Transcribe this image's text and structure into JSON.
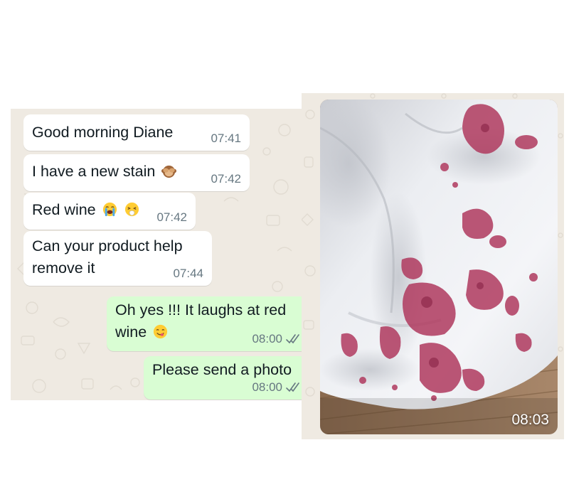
{
  "messages": [
    {
      "direction": "incoming",
      "text": "Good morning Diane",
      "time": "07:41"
    },
    {
      "direction": "incoming",
      "text": "I have a new stain",
      "emoji": [
        "see-no-evil-monkey"
      ],
      "time": "07:42"
    },
    {
      "direction": "incoming",
      "text": "Red wine",
      "emoji": [
        "loudly-crying-face",
        "sneezing-face"
      ],
      "time": "07:42"
    },
    {
      "direction": "incoming",
      "lines": [
        "Can your product help",
        "remove it"
      ],
      "time": "07:44"
    },
    {
      "direction": "outgoing",
      "lines": [
        "Oh yes !!! It laughs at red",
        "wine"
      ],
      "emoji": [
        "face-savoring-food"
      ],
      "time": "08:00",
      "status": "read-double-check"
    },
    {
      "direction": "outgoing",
      "text": "Please send a photo",
      "time": "08:00",
      "status": "read-double-check"
    }
  ],
  "photo": {
    "subject": "white duvet with red wine stains",
    "time": "08:03"
  },
  "colors": {
    "chat_background": "#efeae2",
    "incoming_bubble": "#ffffff",
    "outgoing_bubble": "#d9fdd3",
    "timestamp": "#667781",
    "wine_stain": "#b03a5f"
  }
}
